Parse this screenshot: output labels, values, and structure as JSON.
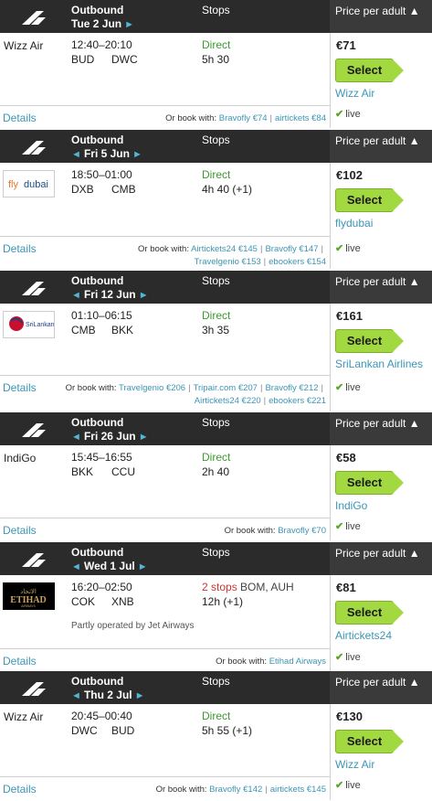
{
  "header": {
    "outbound_label": "Outbound",
    "stops_label": "Stops",
    "price_label": "Price per adult ▲"
  },
  "labels": {
    "select": "Select",
    "details": "Details",
    "or_book": "Or book with:",
    "live": "live"
  },
  "colors": {
    "accent": "#3c95b5",
    "select_green": "#a3d940",
    "direct_green": "#3a9a2e",
    "stops_red": "#cc3333",
    "header_dark": "#2b2b2b"
  },
  "flights": [
    {
      "date": "Tue 2 Jun",
      "show_prev": false,
      "airline": "Wizz Air",
      "logo": "",
      "times": "12:40–20:10",
      "from": "BUD",
      "to": "DWC",
      "stops": "Direct",
      "stops_via": "",
      "duration": "5h 30",
      "partly": "",
      "price": "€71",
      "vendor": "Wizz Air",
      "others": [
        "Bravofly €74",
        "airtickets €84"
      ]
    },
    {
      "date": "Fri 5 Jun",
      "show_prev": true,
      "airline": "flydubai",
      "logo": "flydubai",
      "times": "18:50–01:00",
      "from": "DXB",
      "to": "CMB",
      "stops": "Direct",
      "stops_via": "",
      "duration": "4h 40 (+1)",
      "partly": "",
      "price": "€102",
      "vendor": "flydubai",
      "others": [
        "Airtickets24 €145",
        "Bravofly €147",
        "Travelgenio €153",
        "ebookers €154"
      ]
    },
    {
      "date": "Fri 12 Jun",
      "show_prev": true,
      "airline": "SriLankan Airlines",
      "logo": "SriLankan",
      "times": "01:10–06:15",
      "from": "CMB",
      "to": "BKK",
      "stops": "Direct",
      "stops_via": "",
      "duration": "3h 35",
      "partly": "",
      "price": "€161",
      "vendor": "SriLankan Airlines",
      "others": [
        "Travelgenio €206",
        "Tripair.com €207",
        "Bravofly €212",
        "Airtickets24 €220",
        "ebookers €221"
      ]
    },
    {
      "date": "Fri 26 Jun",
      "show_prev": true,
      "airline": "IndiGo",
      "logo": "",
      "times": "15:45–16:55",
      "from": "BKK",
      "to": "CCU",
      "stops": "Direct",
      "stops_via": "",
      "duration": "2h 40",
      "partly": "",
      "price": "€58",
      "vendor": "IndiGo",
      "others": [
        "Bravofly €70"
      ]
    },
    {
      "date": "Wed 1 Jul",
      "show_prev": true,
      "airline": "Etihad",
      "logo": "ETIHAD",
      "times": "16:20–02:50",
      "from": "COK",
      "to": "XNB",
      "stops": "2 stops",
      "stops_via": "BOM, AUH",
      "duration": "12h (+1)",
      "partly": "Partly operated by Jet Airways",
      "price": "€81",
      "vendor": "Airtickets24",
      "others": [
        "Etihad Airways"
      ]
    },
    {
      "date": "Thu 2 Jul",
      "show_prev": true,
      "airline": "Wizz Air",
      "logo": "",
      "times": "20:45–00:40",
      "from": "DWC",
      "to": "BUD",
      "stops": "Direct",
      "stops_via": "",
      "duration": "5h 55 (+1)",
      "partly": "",
      "price": "€130",
      "vendor": "Wizz Air",
      "others": [
        "Bravofly €142",
        "airtickets €145"
      ]
    }
  ]
}
